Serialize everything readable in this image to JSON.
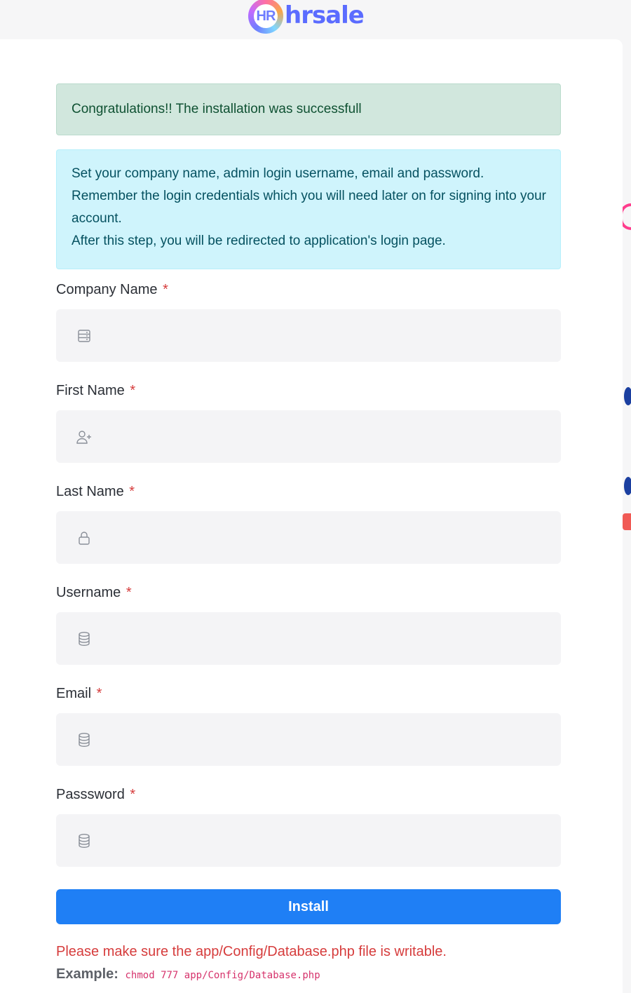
{
  "brand": {
    "logo_mark_text": "HR",
    "logo_text": "hrsale"
  },
  "alerts": {
    "success": "Congratulations!! The installation was successfull",
    "info_lines": [
      "Set your company name, admin login username, email and password.",
      "Remember the login credentials which you will need later on for signing into your account.",
      "After this step, you will be redirected to application's login page."
    ]
  },
  "form": {
    "required_marker": "*",
    "fields": [
      {
        "label": "Company Name",
        "icon": "building-icon",
        "value": "",
        "placeholder": ""
      },
      {
        "label": "First Name",
        "icon": "user-plus-icon",
        "value": "",
        "placeholder": ""
      },
      {
        "label": "Last Name",
        "icon": "lock-icon",
        "value": "",
        "placeholder": ""
      },
      {
        "label": "Username",
        "icon": "database-icon",
        "value": "",
        "placeholder": ""
      },
      {
        "label": "Email",
        "icon": "database-icon",
        "value": "",
        "placeholder": ""
      },
      {
        "label": "Passsword",
        "icon": "database-icon",
        "value": "",
        "placeholder": ""
      }
    ],
    "submit_label": "Install"
  },
  "footer_note": {
    "warning": "Please make sure the app/Config/Database.php file is writable.",
    "example_label": "Example:",
    "example_command": "chmod 777 app/Config/Database.php"
  },
  "colors": {
    "accent": "#1f7ff5",
    "success_bg": "#d1e7dd",
    "info_bg": "#cff4fc",
    "danger": "#d63c3c",
    "input_bg": "#f4f4f6"
  }
}
